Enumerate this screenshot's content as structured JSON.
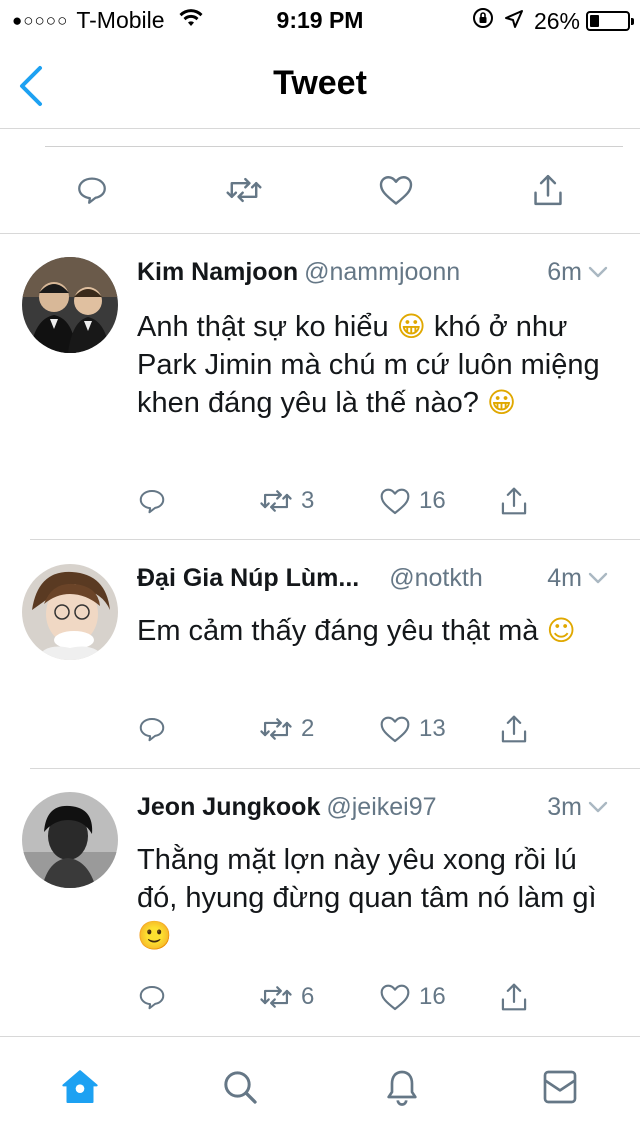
{
  "status_bar": {
    "signal": "●○○○○",
    "carrier": "T-Mobile",
    "time": "9:19 PM",
    "battery_percent": "26%",
    "battery_level": 0.26
  },
  "nav": {
    "title": "Tweet",
    "back_icon": "chevron-left-icon"
  },
  "colors": {
    "accent": "#1da1f2",
    "icon_gray": "#657786",
    "text": "#14171a"
  },
  "replies": [
    {
      "name": "Kim Namjoon",
      "handle": "@nammjoonn",
      "time": "6m",
      "text_parts": [
        "Anh thật sự ko hiểu ",
        "😀",
        " khó ở như Park Jimin mà chú m cứ luôn miệng khen đáng yêu là thế nào? ",
        "😀"
      ],
      "retweets": "3",
      "likes": "16"
    },
    {
      "name": "Đại Gia Núp Lùm...",
      "handle": "@notkth",
      "time": "4m",
      "text_parts": [
        "Em cảm thấy đáng yêu thật mà ",
        "☺"
      ],
      "retweets": "2",
      "likes": "13"
    },
    {
      "name": "Jeon Jungkook",
      "handle": "@jeikei97",
      "time": "3m",
      "text_parts": [
        "Thằng mặt lợn này yêu xong rồi lú đó, hyung đừng quan tâm nó làm gì ",
        "🙂"
      ],
      "retweets": "6",
      "likes": "16"
    }
  ],
  "tabbar": {
    "items": [
      "home-icon",
      "search-icon",
      "notifications-icon",
      "messages-icon"
    ],
    "active": "home-icon"
  }
}
